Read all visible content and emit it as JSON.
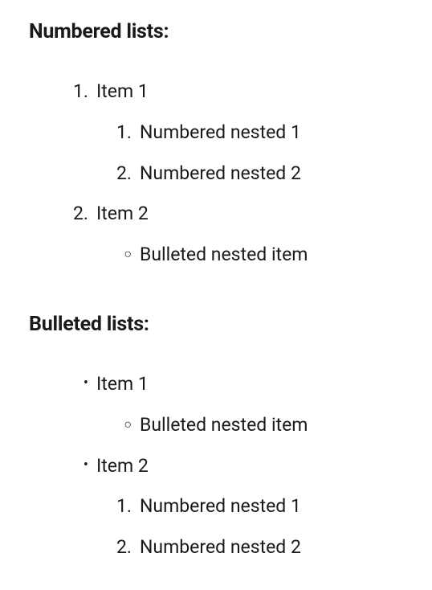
{
  "sections": [
    {
      "heading": "Numbered lists:",
      "type": "numbered",
      "items": [
        {
          "marker": "1.",
          "text": "Item 1",
          "children": {
            "type": "numbered",
            "items": [
              {
                "marker": "1.",
                "text": "Numbered nested 1"
              },
              {
                "marker": "2.",
                "text": "Numbered nested 2"
              }
            ]
          }
        },
        {
          "marker": "2.",
          "text": "Item 2",
          "children": {
            "type": "bulleted-circle",
            "items": [
              {
                "marker": "○",
                "text": "Bulleted nested item"
              }
            ]
          }
        }
      ]
    },
    {
      "heading": "Bulleted lists:",
      "type": "bulleted-disc",
      "items": [
        {
          "marker": "•",
          "text": "Item 1",
          "children": {
            "type": "bulleted-circle",
            "items": [
              {
                "marker": "○",
                "text": "Bulleted nested item"
              }
            ]
          }
        },
        {
          "marker": "•",
          "text": "Item 2",
          "children": {
            "type": "numbered",
            "items": [
              {
                "marker": "1.",
                "text": "Numbered nested 1"
              },
              {
                "marker": "2.",
                "text": "Numbered nested 2"
              }
            ]
          }
        }
      ]
    }
  ]
}
